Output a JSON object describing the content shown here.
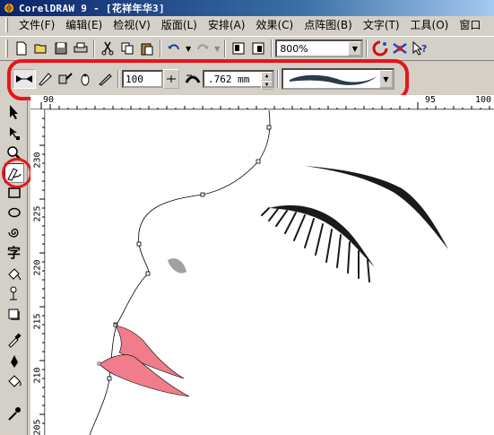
{
  "window": {
    "title": "CorelDRAW 9 - [花祥年华3]"
  },
  "menu": [
    {
      "label": "文件(F)"
    },
    {
      "label": "编辑(E)"
    },
    {
      "label": "检视(V)"
    },
    {
      "label": "版面(L)"
    },
    {
      "label": "安排(A)"
    },
    {
      "label": "效果(C)"
    },
    {
      "label": "点阵图(B)"
    },
    {
      "label": "文字(T)"
    },
    {
      "label": "工具(O)"
    },
    {
      "label": "窗口"
    }
  ],
  "standard_toolbar": {
    "zoom_value": "800%"
  },
  "property_bar": {
    "smoothing_value": "100",
    "width_value": ".762 mm"
  },
  "rulers": {
    "horizontal": [
      "90",
      "95",
      "100"
    ],
    "vertical": [
      "230",
      "225",
      "220",
      "215",
      "210",
      "205"
    ]
  },
  "colors": {
    "highlight": "#e8141a",
    "lips": "#f07c8c",
    "canvas": "#ffffff"
  },
  "icons": [
    "new-icon",
    "open-icon",
    "save-icon",
    "print-icon",
    "cut-icon",
    "copy-icon",
    "paste-icon",
    "undo-icon",
    "redo-icon",
    "import-icon",
    "export-icon",
    "corel-logo-icon",
    "help-icon",
    "pick-tool-icon",
    "shape-tool-icon",
    "zoom-tool-icon",
    "freehand-tool-icon",
    "rectangle-tool-icon",
    "ellipse-tool-icon",
    "spiral-tool-icon",
    "text-tool-icon",
    "fill-tool-icon",
    "eyedropper-icon"
  ]
}
